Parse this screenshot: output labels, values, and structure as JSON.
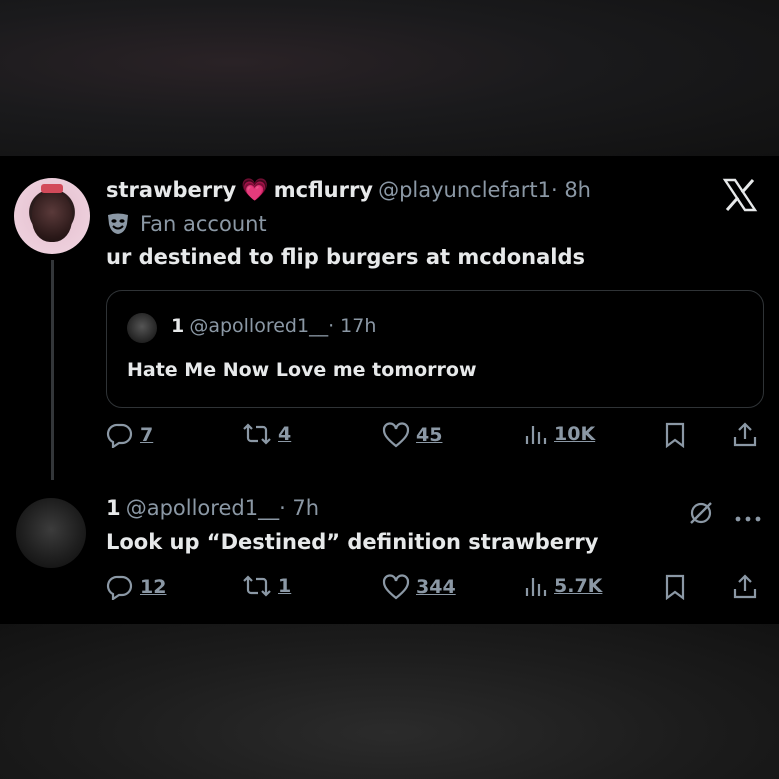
{
  "post": {
    "display_name_a": "strawberry",
    "heart_emoji": "💗",
    "display_name_b": "mcflurry",
    "handle": "@playunclefart1",
    "time": "· 8h",
    "badge_text": "Fan account",
    "body": "ur destined to flip burgers at mcdonalds",
    "quote": {
      "name": "1",
      "handle": "@apollored1__",
      "time": "· 17h",
      "body": "Hate Me Now Love me tomorrow"
    },
    "stats": {
      "replies": "7",
      "reposts": "4",
      "likes": "45",
      "views": "10K"
    }
  },
  "reply": {
    "name": "1",
    "handle": "@apollored1__",
    "time": "· 7h",
    "body": "Look up “Destined” definition strawberry",
    "stats": {
      "replies": "12",
      "reposts": "1",
      "likes": "344",
      "views": "5.7K"
    }
  },
  "icons": [
    "x-logo-icon",
    "reply-icon",
    "repost-icon",
    "like-icon",
    "views-icon",
    "bookmark-icon",
    "share-icon",
    "grok-icon",
    "more-icon",
    "theater-mask-icon"
  ]
}
